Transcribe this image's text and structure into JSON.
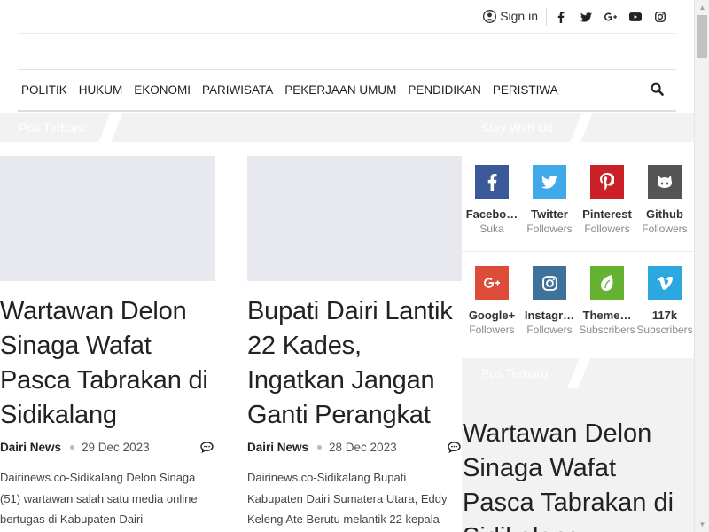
{
  "header": {
    "signin_label": "Sign in",
    "social_icons": [
      "facebook-icon",
      "twitter-icon",
      "google-plus-icon",
      "youtube-icon",
      "instagram-icon"
    ]
  },
  "nav": {
    "items": [
      "POLITIK",
      "HUKUM",
      "EKONOMI",
      "PARIWISATA",
      "PEKERJAAN UMUM",
      "PENDIDIKAN",
      "PERISTIWA"
    ]
  },
  "main": {
    "section_title": "Pos Terbaru",
    "posts": [
      {
        "title": "Wartawan Delon Sinaga Wafat Pasca Tabrakan di Sidikalang",
        "author": "Dairi News",
        "date": "29 Dec 2023",
        "excerpt": "Dairinews.co-Sidikalang Delon Sinaga (51) wartawan salah satu media online bertugas di Kabupaten Dairi"
      },
      {
        "title": "Bupati Dairi Lantik 22 Kades, Ingatkan Jangan Ganti Perangkat",
        "author": "Dairi News",
        "date": "28 Dec 2023",
        "excerpt": "Dairinews.co-Sidikalang Bupati Kabupaten Dairi Sumatera Utara, Eddy Keleng Ate Berutu melantik 22 kepala"
      }
    ]
  },
  "sidebar": {
    "stay_title": "Stay With Us",
    "socials": [
      {
        "name": "Facebo…",
        "sub": "Suka",
        "color": "#3b5998",
        "icon": "facebook-icon"
      },
      {
        "name": "Twitter",
        "sub": "Followers",
        "color": "#40a9ea",
        "icon": "twitter-icon"
      },
      {
        "name": "Pinterest",
        "sub": "Followers",
        "color": "#cb2027",
        "icon": "pinterest-icon"
      },
      {
        "name": "Github",
        "sub": "Followers",
        "color": "#555555",
        "icon": "github-icon"
      },
      {
        "name": "Google+",
        "sub": "Followers",
        "color": "#dd4b39",
        "icon": "google-plus-icon"
      },
      {
        "name": "Instagr…",
        "sub": "Followers",
        "color": "#3f729b",
        "icon": "instagram-icon"
      },
      {
        "name": "Theme…",
        "sub": "Subscribers",
        "color": "#65b230",
        "icon": "themeforest-icon"
      },
      {
        "name": "117k",
        "sub": "Subscribers",
        "color": "#2ca7e0",
        "icon": "vimeo-icon"
      }
    ],
    "recent_title": "Pos Terbaru",
    "recent_post_title": "Wartawan Delon Sinaga Wafat Pasca Tabrakan di Sidikalang"
  }
}
